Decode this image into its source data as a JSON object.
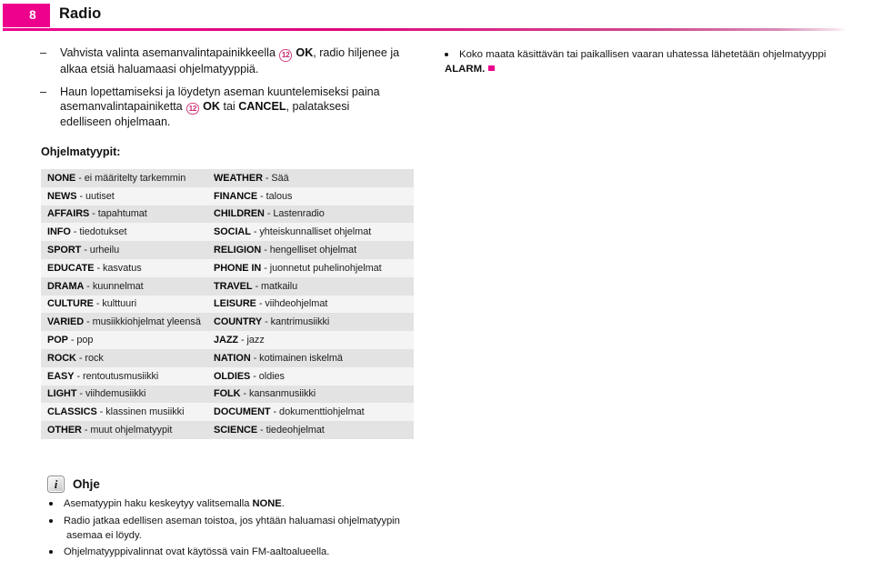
{
  "header": {
    "page_number": "8",
    "title": "Radio",
    "accent_color": "#ec008c"
  },
  "instructions": [
    {
      "marker": "–",
      "parts": [
        {
          "type": "text",
          "value": "Vahvista valinta asemanvalintapainikkeella "
        },
        {
          "type": "key",
          "value": "12"
        },
        {
          "type": "bold",
          "value": " OK"
        },
        {
          "type": "text",
          "value": ", radio hiljenee ja alkaa etsiä haluamaasi ohjelmatyyppiä."
        }
      ]
    },
    {
      "marker": "–",
      "parts": [
        {
          "type": "text",
          "value": "Haun lopettamiseksi ja löydetyn aseman kuuntelemiseksi paina asemanvalintapainiketta "
        },
        {
          "type": "key",
          "value": "12"
        },
        {
          "type": "bold",
          "value": " OK"
        },
        {
          "type": "text",
          "value": " tai "
        },
        {
          "type": "bold",
          "value": "CANCEL"
        },
        {
          "type": "text",
          "value": ", palataksesi edelliseen ohjelmaan."
        }
      ]
    }
  ],
  "note_right": {
    "bullet_text": "Koko maata käsittävän tai paikallisen vaaran uhatessa lähetetään ohjelmatyyppi",
    "alarm_label": "ALARM.",
    "end_marker_color": "#ec008c"
  },
  "types_label": "Ohjelmatyypit:",
  "program_types": [
    {
      "left_code": "NONE",
      "left_desc": "- ei määritelty tarkemmin",
      "right_code": "WEATHER",
      "right_desc": "- Sää"
    },
    {
      "left_code": "NEWS",
      "left_desc": "- uutiset",
      "right_code": "FINANCE",
      "right_desc": "- talous"
    },
    {
      "left_code": "AFFAIRS",
      "left_desc": "- tapahtumat",
      "right_code": "CHILDREN",
      "right_desc": "- Lastenradio"
    },
    {
      "left_code": "INFO",
      "left_desc": "- tiedotukset",
      "right_code": "SOCIAL",
      "right_desc": "- yhteiskunnalliset ohjelmat"
    },
    {
      "left_code": "SPORT",
      "left_desc": "- urheilu",
      "right_code": "RELIGION",
      "right_desc": "- hengelliset ohjelmat"
    },
    {
      "left_code": "EDUCATE",
      "left_desc": "- kasvatus",
      "right_code": "PHONE IN",
      "right_desc": "- juonnetut puhelinohjelmat"
    },
    {
      "left_code": "DRAMA",
      "left_desc": "- kuunnelmat",
      "right_code": "TRAVEL",
      "right_desc": "- matkailu"
    },
    {
      "left_code": "CULTURE",
      "left_desc": "- kulttuuri",
      "right_code": "LEISURE",
      "right_desc": "- viihdeohjelmat"
    },
    {
      "left_code": "VARIED",
      "left_desc": "- musiikkiohjelmat yleensä",
      "right_code": "COUNTRY",
      "right_desc": "- kantrimusiikki"
    },
    {
      "left_code": "POP",
      "left_desc": "- pop",
      "right_code": "JAZZ",
      "right_desc": "- jazz"
    },
    {
      "left_code": "ROCK",
      "left_desc": "- rock",
      "right_code": "NATION",
      "right_desc": "- kotimainen iskelmä"
    },
    {
      "left_code": "EASY",
      "left_desc": "- rentoutusmusiikki",
      "right_code": "OLDIES",
      "right_desc": "- oldies"
    },
    {
      "left_code": "LIGHT",
      "left_desc": "- viihdemusiikki",
      "right_code": "FOLK",
      "right_desc": "- kansanmusiikki"
    },
    {
      "left_code": "CLASSICS",
      "left_desc": "- klassinen musiikki",
      "right_code": "DOCUMENT",
      "right_desc": "- dokumenttiohjelmat"
    },
    {
      "left_code": "OTHER",
      "left_desc": "- muut ohjelmatyypit",
      "right_code": "SCIENCE",
      "right_desc": "- tiedeohjelmat"
    }
  ],
  "ohje": {
    "icon_name": "info-icon",
    "icon_glyph": "i",
    "title": "Ohje",
    "bullets": [
      {
        "parts": [
          {
            "type": "text",
            "value": "Asematyypin haku keskeytyy valitsemalla "
          },
          {
            "type": "bold",
            "value": "NONE"
          },
          {
            "type": "text",
            "value": "."
          }
        ]
      },
      {
        "parts": [
          {
            "type": "text",
            "value": "Radio jatkaa edellisen aseman toistoa, jos yhtään haluamasi ohjelmatyypin asemaa ei löydy."
          }
        ]
      },
      {
        "parts": [
          {
            "type": "text",
            "value": "Ohjelmatyyppivalinnat ovat käytössä vain FM-aaltoalueella."
          }
        ]
      }
    ]
  }
}
